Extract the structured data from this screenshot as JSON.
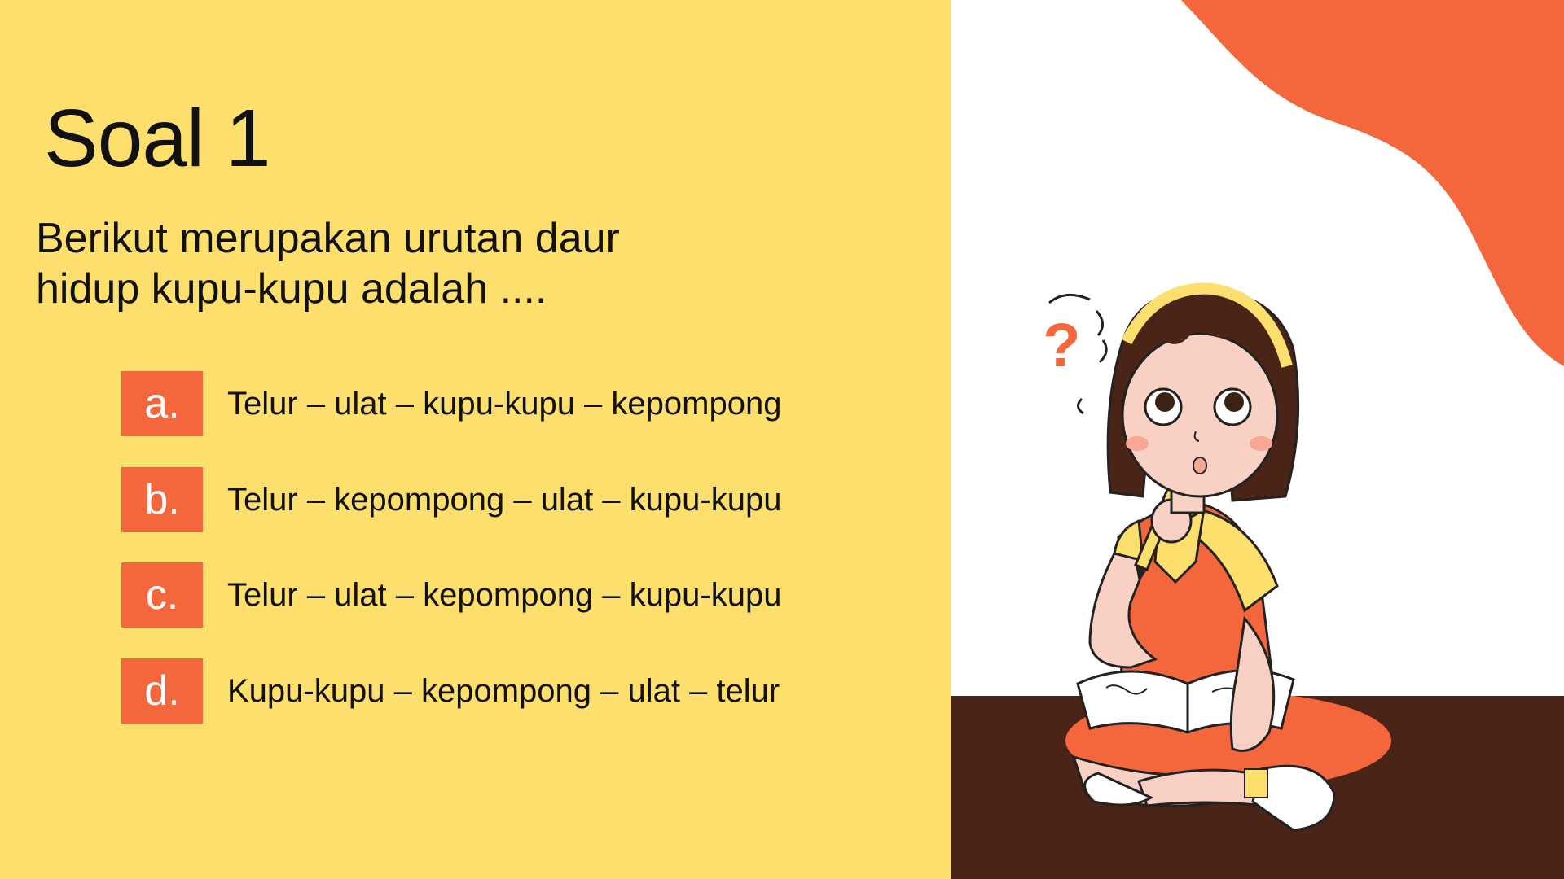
{
  "slide": {
    "title": "Soal 1",
    "question": " Berikut merupakan urutan daur\nhidup kupu-kupu adalah ....",
    "options": [
      {
        "letter": "a.",
        "text": "Telur – ulat – kupu-kupu – kepompong"
      },
      {
        "letter": "b.",
        "text": "Telur – kepompong – ulat – kupu-kupu"
      },
      {
        "letter": "c.",
        "text": "Telur – ulat – kepompong – kupu-kupu"
      },
      {
        "letter": "d.",
        "text": "Kupu-kupu – kepompong – ulat – telur"
      }
    ],
    "illustration": {
      "question_mark": "?"
    },
    "colors": {
      "left_background": "#FDDF6E",
      "accent": "#F4673D",
      "floor": "#4A2416",
      "text": "#111111"
    }
  }
}
